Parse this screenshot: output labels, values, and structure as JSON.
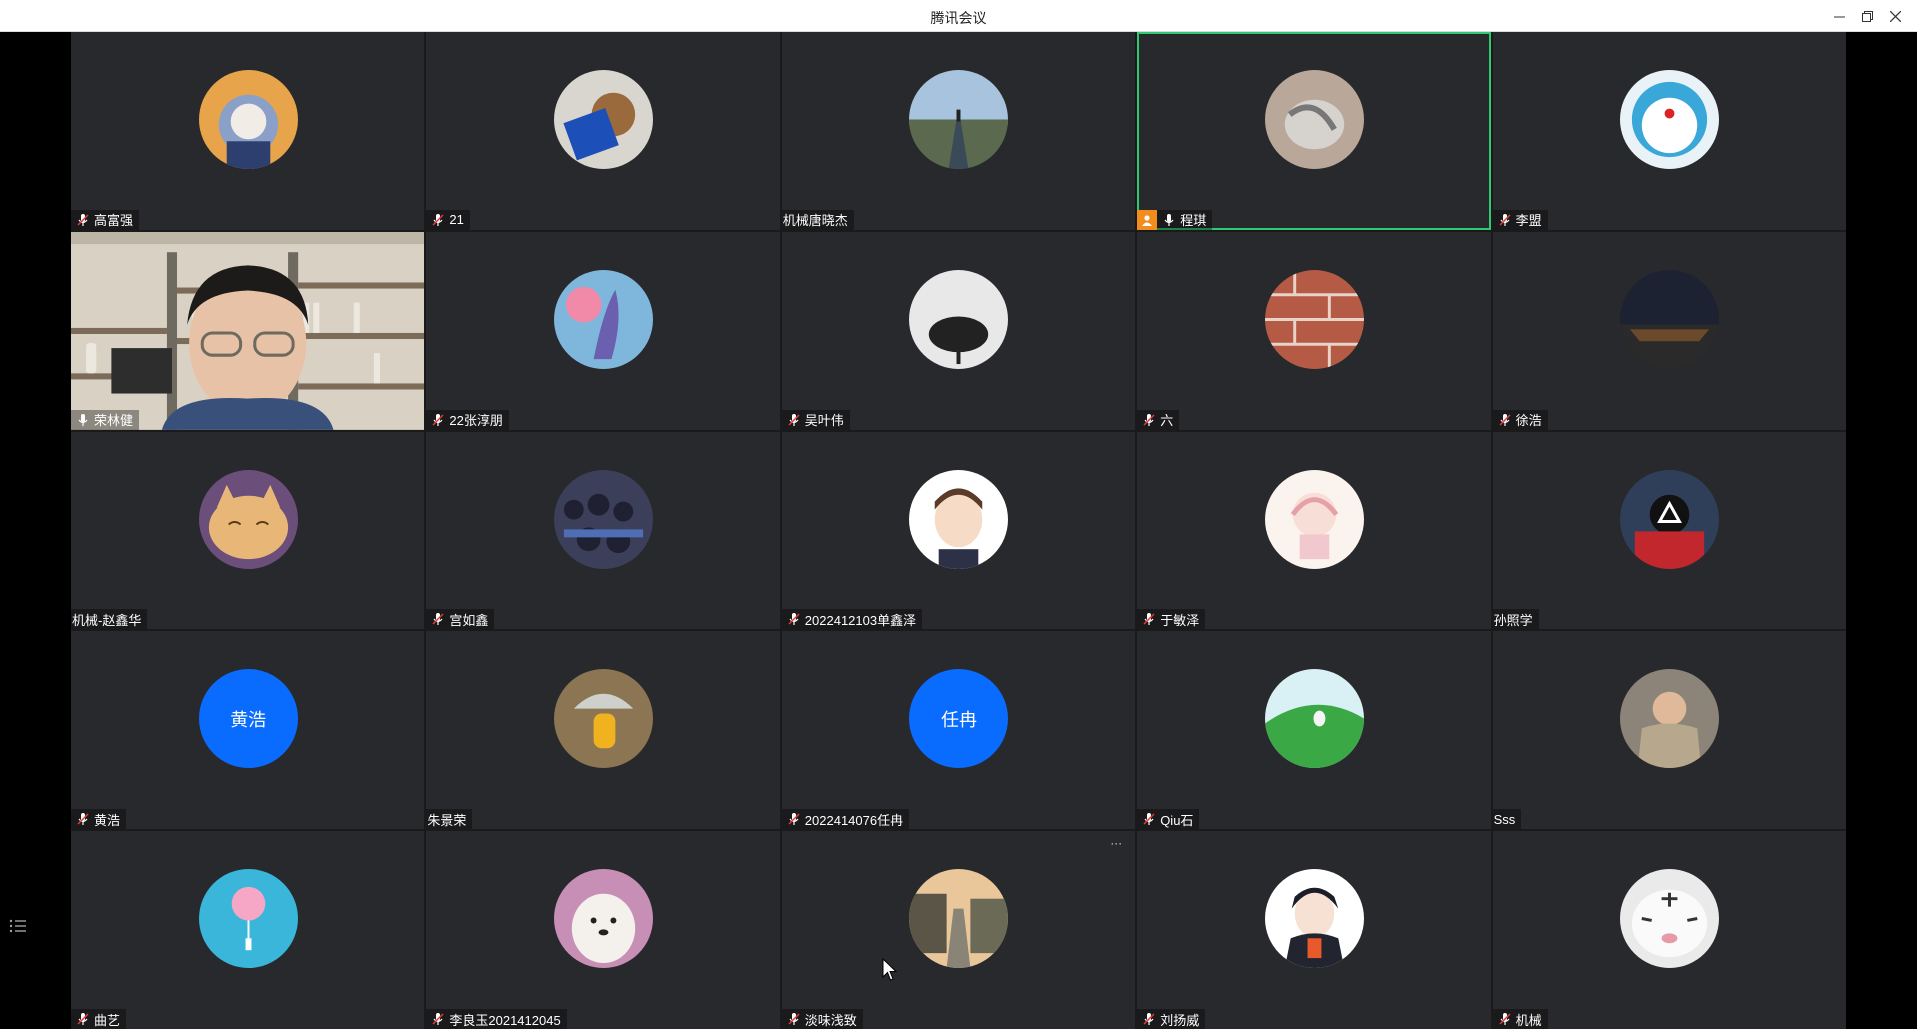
{
  "window": {
    "title": "腾讯会议"
  },
  "colors": {
    "tile_bg": "#28292c",
    "active_border": "#2fc971",
    "text_avatar_bg": "#0a6cff",
    "host_badge": "#f28c1a"
  },
  "participants": [
    {
      "name": "高富强",
      "mic": "muted",
      "avatar": "cat-hoodie"
    },
    {
      "name": "21",
      "mic": "muted",
      "avatar": "bear-flag"
    },
    {
      "name": "机械唐晓杰",
      "mic": "none",
      "avatar": "road-landscape"
    },
    {
      "name": "程琪",
      "mic": "on",
      "host": true,
      "active": true,
      "avatar": "gray-photo"
    },
    {
      "name": "李盟",
      "mic": "muted",
      "avatar": "doraemon"
    },
    {
      "name": "荣林健",
      "mic": "on",
      "video": true
    },
    {
      "name": "22张淳朋",
      "mic": "muted",
      "avatar": "dragon-art"
    },
    {
      "name": "吴叶伟",
      "mic": "muted",
      "avatar": "bw-tree"
    },
    {
      "name": "六",
      "mic": "muted",
      "avatar": "brick-wall"
    },
    {
      "name": "徐浩",
      "mic": "muted",
      "avatar": "titanic-night"
    },
    {
      "name": "机械-赵鑫华",
      "mic": "none",
      "avatar": "sleepy-cat"
    },
    {
      "name": "宫如鑫",
      "mic": "muted",
      "avatar": "crowd"
    },
    {
      "name": "2022412103单鑫泽",
      "mic": "muted",
      "avatar": "cartoon-boy"
    },
    {
      "name": "于敏泽",
      "mic": "muted",
      "avatar": "anime-sketch"
    },
    {
      "name": "孙照学",
      "mic": "none",
      "avatar": "squid-guard"
    },
    {
      "name": "黄浩",
      "mic": "muted",
      "avatar_text": "黄浩"
    },
    {
      "name": "朱景荣",
      "mic": "none",
      "avatar": "yellow-raincoat"
    },
    {
      "name": "2022414076任冉",
      "mic": "muted",
      "avatar_text": "任冉"
    },
    {
      "name": "Qiu石",
      "mic": "muted",
      "avatar": "green-hill"
    },
    {
      "name": "Sss",
      "mic": "none",
      "avatar": "boy-hoodie"
    },
    {
      "name": "曲艺",
      "mic": "muted",
      "avatar": "cotton-candy"
    },
    {
      "name": "李良玉2021412045",
      "mic": "muted",
      "avatar": "samoyed"
    },
    {
      "name": "淡味浅致",
      "mic": "muted",
      "avatar": "village-street",
      "has_more": true
    },
    {
      "name": "刘扬威",
      "mic": "muted",
      "avatar": "anime-boy"
    },
    {
      "name": "机械",
      "mic": "muted",
      "avatar": "white-tiger"
    }
  ],
  "more_label": "···"
}
